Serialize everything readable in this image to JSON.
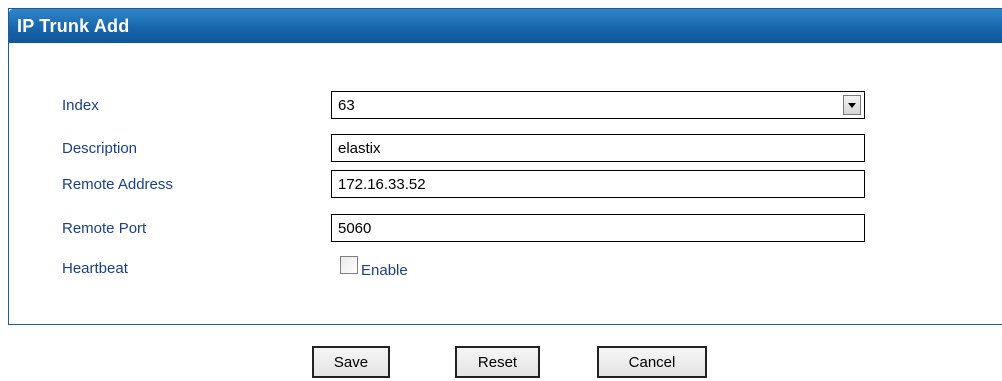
{
  "panel": {
    "title": "IP Trunk Add"
  },
  "form": {
    "index": {
      "label": "Index",
      "value": "63"
    },
    "description": {
      "label": "Description",
      "value": "elastix"
    },
    "remote_address": {
      "label": "Remote Address",
      "value": "172.16.33.52"
    },
    "remote_port": {
      "label": "Remote Port",
      "value": "5060"
    },
    "heartbeat": {
      "label": "Heartbeat",
      "checkbox_label": "Enable",
      "checked": false
    }
  },
  "buttons": {
    "save": "Save",
    "reset": "Reset",
    "cancel": "Cancel"
  },
  "colors": {
    "titlebar": "#1866ad",
    "label_text": "#1a3f8c",
    "border": "#1a5e9a"
  },
  "icons": {
    "dropdown": "chevron-down-icon",
    "checkbox": "checkbox-icon"
  }
}
